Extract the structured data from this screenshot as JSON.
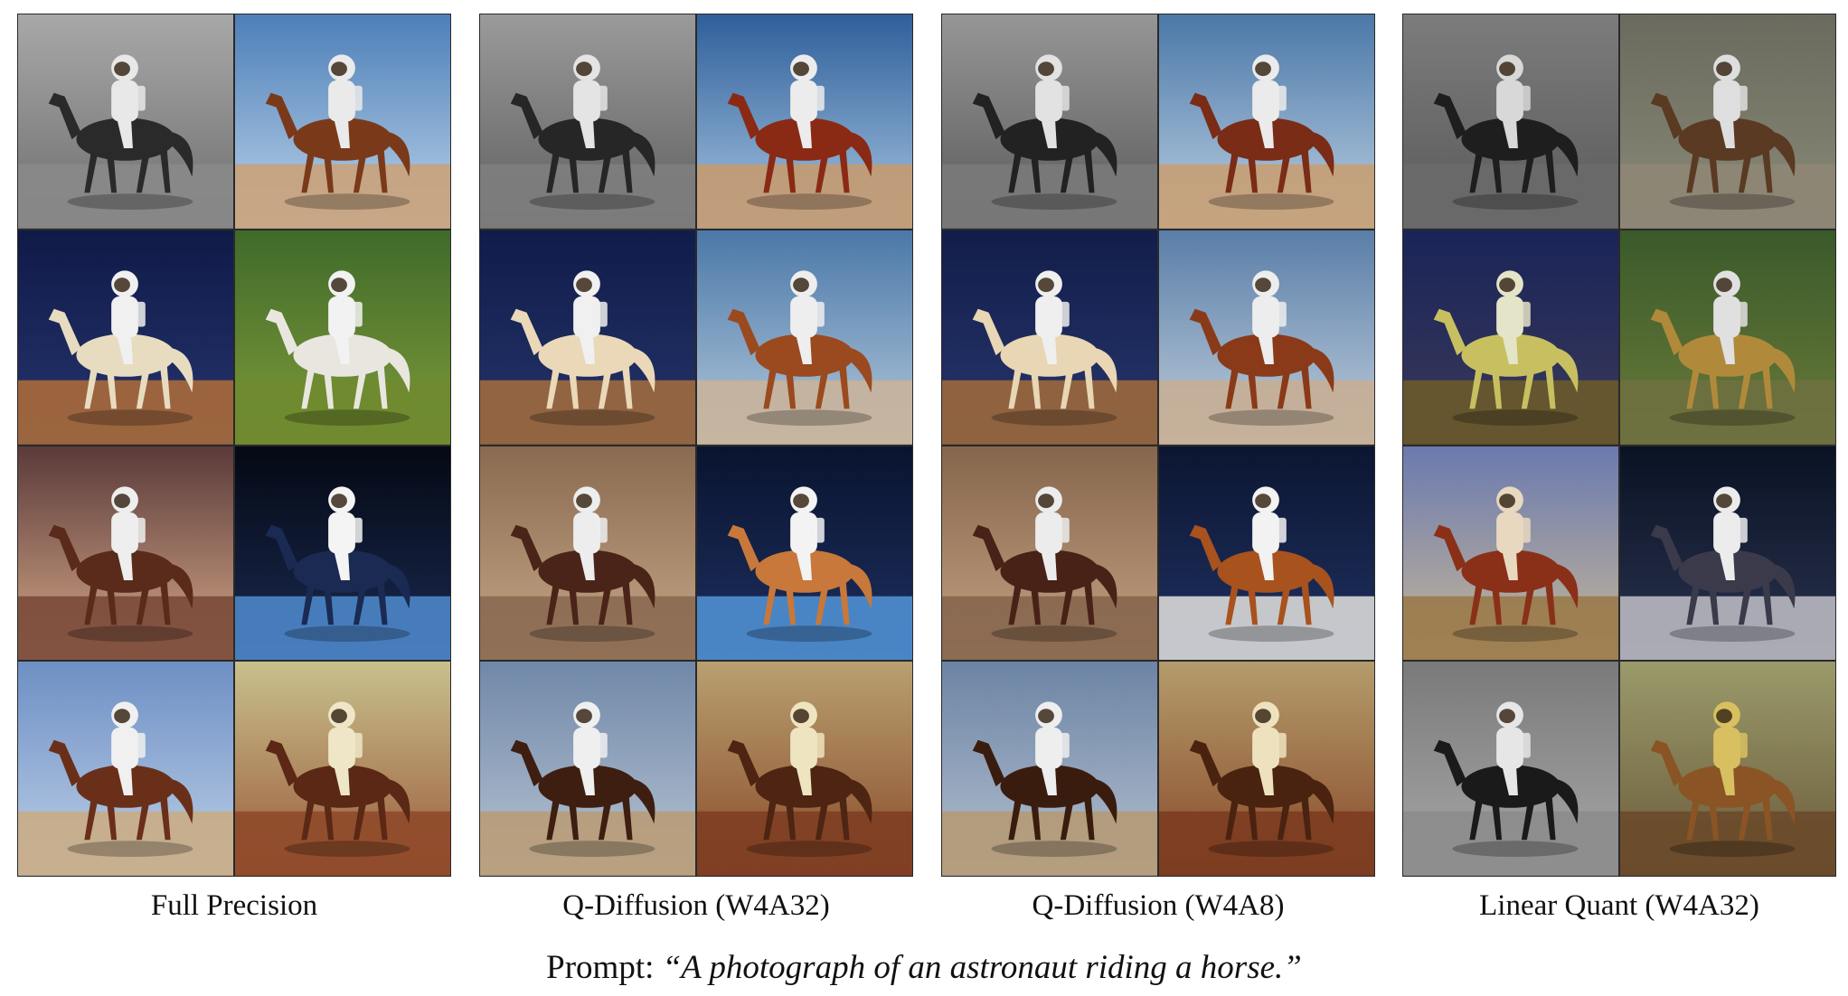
{
  "figure": {
    "panels": [
      {
        "caption": "Full Precision",
        "tiles": [
          {
            "bg": [
              "#a8a8a8",
              "#6e6e6e"
            ],
            "ground": "#8a8a8a",
            "horse": "#2a2a2a",
            "rider": "#e8e8e8"
          },
          {
            "bg": [
              "#4d7fb8",
              "#bcd4ea"
            ],
            "ground": "#c9a27a",
            "horse": "#7a3a1a",
            "rider": "#eaeaea"
          },
          {
            "bg": [
              "#0f1a48",
              "#27356e"
            ],
            "ground": "#a86a3a",
            "horse": "#e8dcc0",
            "rider": "#f0f0f0"
          },
          {
            "bg": [
              "#3f6a2a",
              "#7f9b3a"
            ],
            "ground": "#6f8a2f",
            "horse": "#e9e6df",
            "rider": "#f2f2f2"
          },
          {
            "bg": [
              "#5a3a3a",
              "#d6a988"
            ],
            "ground": "#7a4a3a",
            "horse": "#5a2a1a",
            "rider": "#eeeeee"
          },
          {
            "bg": [
              "#050914",
              "#1a2a52"
            ],
            "ground": "#4c86c9",
            "horse": "#1a2a52",
            "rider": "#f4f4f4"
          },
          {
            "bg": [
              "#6e8fc4",
              "#bcd0e8"
            ],
            "ground": "#c9ac85",
            "horse": "#6a2f18",
            "rider": "#f0f0f0"
          },
          {
            "bg": [
              "#c8c08c",
              "#9a5a3a"
            ],
            "ground": "#8f4a2a",
            "horse": "#5a2814",
            "rider": "#efe6c8"
          }
        ]
      },
      {
        "caption": "Q-Diffusion (W4A32)",
        "tiles": [
          {
            "bg": [
              "#9a9a9a",
              "#5e5e5e"
            ],
            "ground": "#7e7e7e",
            "horse": "#262626",
            "rider": "#e4e4e4"
          },
          {
            "bg": [
              "#2f5f9a",
              "#a8c6e2"
            ],
            "ground": "#c49a70",
            "horse": "#8a2a14",
            "rider": "#ececec"
          },
          {
            "bg": [
              "#101c4a",
              "#25346a"
            ],
            "ground": "#9f6a3e",
            "horse": "#ead8b8",
            "rider": "#f0f0f0"
          },
          {
            "bg": [
              "#4b78a8",
              "#b4c9dc"
            ],
            "ground": "#c8b29a",
            "horse": "#9a4a1e",
            "rider": "#eeeeee"
          },
          {
            "bg": [
              "#8a6a50",
              "#c8a888"
            ],
            "ground": "#8a6a52",
            "horse": "#4a2418",
            "rider": "#ededed"
          },
          {
            "bg": [
              "#0a1430",
              "#1e3060"
            ],
            "ground": "#4f8fd0",
            "horse": "#c8783a",
            "rider": "#f3f3f3"
          },
          {
            "bg": [
              "#7088a8",
              "#b8c4d4"
            ],
            "ground": "#b89c78",
            "horse": "#3e1e10",
            "rider": "#efefef"
          },
          {
            "bg": [
              "#b8a070",
              "#8a4a2a"
            ],
            "ground": "#7e3e22",
            "horse": "#4e2412",
            "rider": "#efe4c0"
          }
        ]
      },
      {
        "caption": "Q-Diffusion (W4A8)",
        "tiles": [
          {
            "bg": [
              "#969696",
              "#5a5a5a"
            ],
            "ground": "#7a7a7a",
            "horse": "#222222",
            "rider": "#e2e2e2"
          },
          {
            "bg": [
              "#4b78a8",
              "#bcd0e2"
            ],
            "ground": "#c69e74",
            "horse": "#7a2c16",
            "rider": "#ebebeb"
          },
          {
            "bg": [
              "#121d4a",
              "#27366c"
            ],
            "ground": "#9c683c",
            "horse": "#e8d6b4",
            "rider": "#efefef"
          },
          {
            "bg": [
              "#5a7ea8",
              "#c0cedc"
            ],
            "ground": "#c6ae94",
            "horse": "#8a3a18",
            "rider": "#ededed"
          },
          {
            "bg": [
              "#86664c",
              "#c4a284"
            ],
            "ground": "#86664e",
            "horse": "#482216",
            "rider": "#ececec"
          },
          {
            "bg": [
              "#0c1632",
              "#203262"
            ],
            "ground": "#d8d8d8",
            "horse": "#a8521e",
            "rider": "#f2f2f2"
          },
          {
            "bg": [
              "#6c84a4",
              "#b4c0d0"
            ],
            "ground": "#b49a76",
            "horse": "#3a1c0e",
            "rider": "#eeeeee"
          },
          {
            "bg": [
              "#b49c6c",
              "#884828"
            ],
            "ground": "#7c3c20",
            "horse": "#4a2210",
            "rider": "#eee2be"
          }
        ]
      },
      {
        "caption": "Linear Quant (W4A32)",
        "tiles": [
          {
            "bg": [
              "#7c7c7c",
              "#5a5a5a"
            ],
            "ground": "#6a6a6a",
            "horse": "#1e1e1e",
            "rider": "#d8d8d8"
          },
          {
            "bg": [
              "#6a6a5e",
              "#8a8a78"
            ],
            "ground": "#8e8676",
            "horse": "#5a3a22",
            "rider": "#dedede"
          },
          {
            "bg": [
              "#1a2458",
              "#3a3a5a"
            ],
            "ground": "#6a5a2a",
            "horse": "#c8c060",
            "rider": "#e4e4c8"
          },
          {
            "bg": [
              "#3a5a2a",
              "#6a7a3a"
            ],
            "ground": "#6e7040",
            "horse": "#b08a3a",
            "rider": "#e0e0e0"
          },
          {
            "bg": [
              "#6a7ab0",
              "#c8b898"
            ],
            "ground": "#9a7a4a",
            "horse": "#8a3018",
            "rider": "#e8d8c0"
          },
          {
            "bg": [
              "#0a1224",
              "#2a3450"
            ],
            "ground": "#b8b8c0",
            "horse": "#3a3a4a",
            "rider": "#ececec"
          },
          {
            "bg": [
              "#7a7a7a",
              "#a8a8a8"
            ],
            "ground": "#8c8c8c",
            "horse": "#1a1a1a",
            "rider": "#e6e6e6"
          },
          {
            "bg": [
              "#9a9a6a",
              "#6a5a3a"
            ],
            "ground": "#6a4a2a",
            "horse": "#8a5424",
            "rider": "#d8c060"
          }
        ]
      }
    ],
    "prompt_label": "Prompt:",
    "prompt_text": "“A photograph of an astronaut riding a horse.”"
  }
}
